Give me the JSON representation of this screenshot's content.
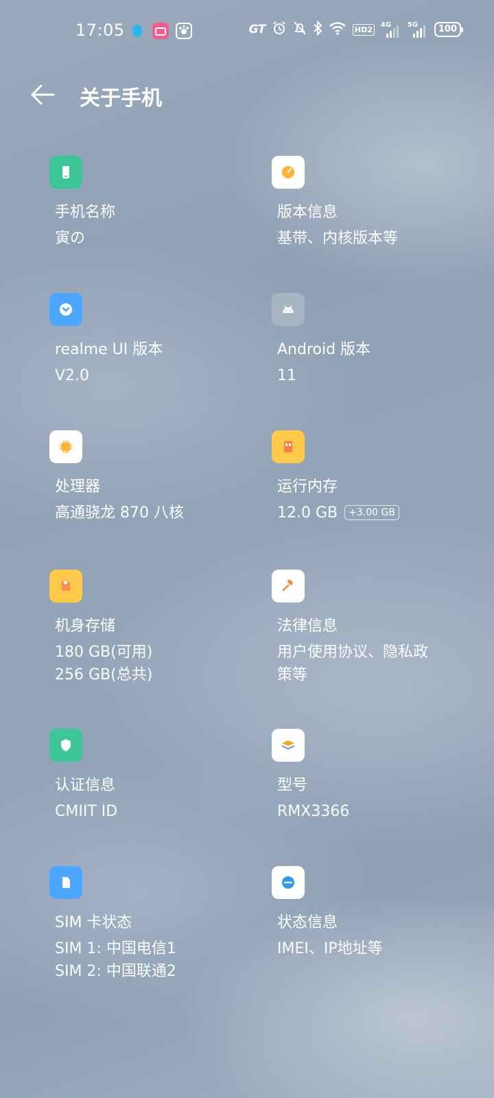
{
  "status_bar": {
    "time": "17:05",
    "gt_label": "GT",
    "hd_label": "HD2",
    "sim1_net": "4G",
    "sim2_net": "5G",
    "battery": "100",
    "app_icon_colors": [
      "#22b8f0",
      "#f25d8e",
      "#ffffff"
    ]
  },
  "header": {
    "title": "关于手机"
  },
  "tiles": [
    {
      "label": "手机名称",
      "value": "寅の",
      "icon": "phone-icon",
      "bg": "#3ec596",
      "fg": "#ffffff"
    },
    {
      "label": "版本信息",
      "value": "基带、内核版本等",
      "icon": "version-gauge-icon",
      "bg": "#ffffff",
      "fg": "#fbb437"
    },
    {
      "label": "realme UI 版本",
      "value": "V2.0",
      "icon": "realme-ui-icon",
      "bg": "#4da6ff",
      "fg": "#ffffff"
    },
    {
      "label": "Android 版本",
      "value": "11",
      "icon": "android-icon",
      "bg": "#a9b4c3",
      "fg": "#ffffff"
    },
    {
      "label": "处理器",
      "value": "高通骁龙 870 八核",
      "icon": "processor-chip-icon",
      "bg": "#ffffff",
      "fg": "#fbb437"
    },
    {
      "label": "运行内存",
      "value": "12.0 GB",
      "chip": "+3.00 GB",
      "icon": "ram-icon",
      "bg": "#ffc94a",
      "fg": "#ff7a45"
    },
    {
      "label": "机身存储",
      "value": "180 GB(可用)",
      "value2": "256 GB(总共)",
      "icon": "storage-icon",
      "bg": "#ffc94a",
      "fg": "#ff8a5b"
    },
    {
      "label": "法律信息",
      "value": "用户使用协议、隐私政",
      "value2": "策等",
      "icon": "gavel-icon",
      "bg": "#ffffff",
      "fg": "#f08a3c"
    },
    {
      "label": "认证信息",
      "value": "CMIIT ID",
      "icon": "shield-icon",
      "bg": "#3ec596",
      "fg": "#ffffff"
    },
    {
      "label": "型号",
      "value": "RMX3366",
      "icon": "layers-icon",
      "bg": "#ffffff",
      "fg": "#f5a623"
    },
    {
      "label": "SIM 卡状态",
      "value": "SIM 1: 中国电信1",
      "value2": "SIM 2: 中国联通2",
      "icon": "sim-card-icon",
      "bg": "#4da6ff",
      "fg": "#ffffff"
    },
    {
      "label": "状态信息",
      "value": "IMEI、IP地址等",
      "icon": "status-info-icon",
      "bg": "#ffffff",
      "fg": "#2f9bef"
    }
  ]
}
